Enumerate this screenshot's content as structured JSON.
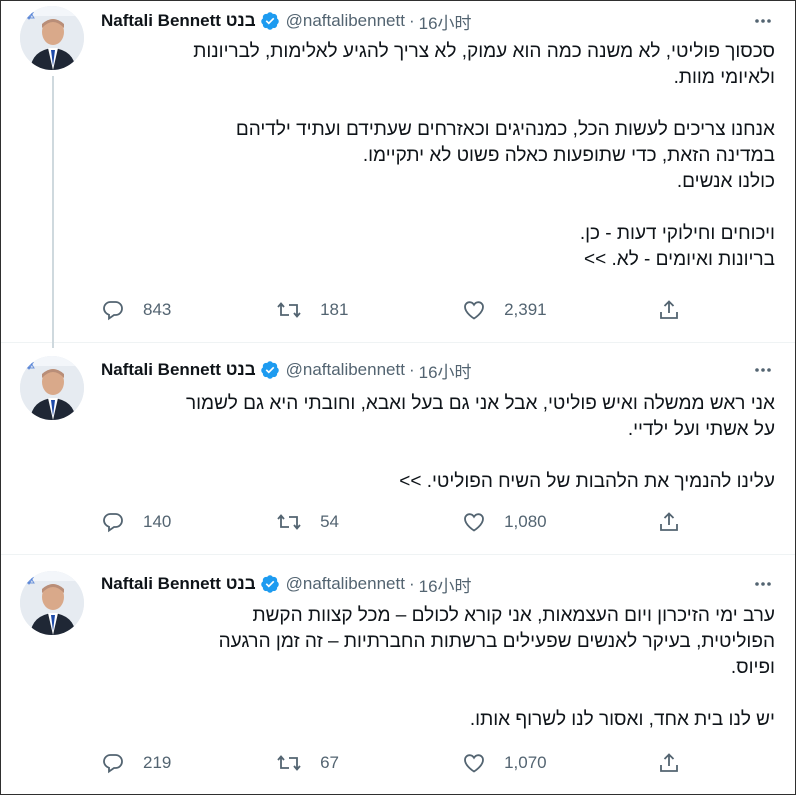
{
  "author": {
    "name": "Naftali Bennett בנט",
    "handle": "@naftalibennett",
    "separator": "·"
  },
  "colors": {
    "text": "#0f1419",
    "secondary": "#536471",
    "verified": "#1d9bf0",
    "thread_line": "#cfd9de"
  },
  "icons": {
    "reply": "speech-bubble",
    "retweet": "arrows-loop",
    "like": "heart",
    "share": "upload-arrow",
    "more": "three-dots"
  },
  "tweets": [
    {
      "time": "16小时",
      "paragraphs": [
        [
          "סכסוך פוליטי, לא משנה כמה הוא עמוק, לא צריך להגיע לאלימות, לבריונות",
          "ולאיומי מוות."
        ],
        [
          "אנחנו צריכים לעשות הכל, כמנהיגים וכאזרחים שעתידם ועתיד ילדיהם",
          "במדינה הזאת, כדי שתופעות כאלה פשוט לא יתקיימו.",
          "כולנו אנשים."
        ],
        [
          "ויכוחים וחילוקי דעות - כן.",
          "בריונות ואיומים - לא. >>"
        ]
      ],
      "replies": "843",
      "retweets": "181",
      "likes": "2,391"
    },
    {
      "time": "16小时",
      "paragraphs": [
        [
          "אני ראש ממשלה ואיש פוליטי, אבל אני גם בעל ואבא, וחובתי היא גם לשמור",
          "על אשתי ועל ילדיי."
        ],
        [
          "עלינו להנמיך את הלהבות של השיח הפוליטי. >>"
        ]
      ],
      "replies": "140",
      "retweets": "54",
      "likes": "1,080"
    },
    {
      "time": "16小时",
      "paragraphs": [
        [
          "ערב ימי הזיכרון ויום העצמאות, אני קורא לכולם – מכל קצוות הקשת",
          "הפוליטית, בעיקר לאנשים שפעילים ברשתות החברתיות – זה זמן הרגעה",
          "ופיוס."
        ],
        [
          "יש לנו בית אחד, ואסור לנו לשרוף אותו."
        ]
      ],
      "replies": "219",
      "retweets": "67",
      "likes": "1,070"
    }
  ]
}
